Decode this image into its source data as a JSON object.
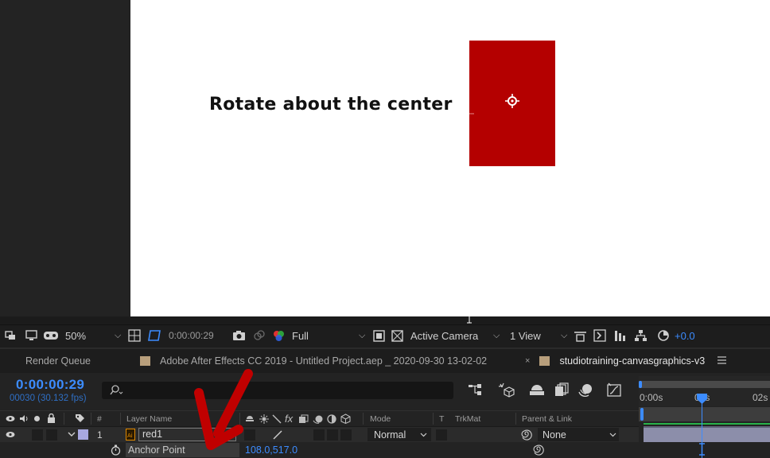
{
  "canvas": {
    "text": "Rotate about the center",
    "layer_color": "#b40000"
  },
  "viewer_toolbar": {
    "zoom": "50%",
    "timecode": "0:00:00:29",
    "resolution": "Full",
    "camera": "Active Camera",
    "view_layout": "1 View",
    "exposure": "+0.0"
  },
  "tabs": [
    {
      "label": "Render Queue",
      "active": false
    },
    {
      "label": "Adobe After Effects CC 2019 - Untitled Project.aep _ 2020-09-30 13-02-02",
      "swatch": "#b89f7c",
      "active": false
    },
    {
      "label": "studiotraining-canvasgraphics-v3",
      "swatch": "#b89f7c",
      "active": true,
      "close": "×"
    }
  ],
  "timeline": {
    "current_time": "0:00:00:29",
    "frame_info": "00030 (30.132 fps)",
    "columns": {
      "index": "#",
      "layer_name": "Layer Name",
      "switches": "fx",
      "mode": "Mode",
      "t": "T",
      "trkmat": "TrkMat",
      "parent": "Parent & Link"
    },
    "ruler": [
      "0:00s",
      "01s",
      "02s"
    ],
    "layer": {
      "index": "1",
      "name": "red1",
      "mode": "Normal",
      "parent": "None",
      "label_color": "#a8a8e0"
    },
    "property": {
      "name": "Anchor Point",
      "value": "108.0,517.0"
    }
  },
  "colors": {
    "accent": "#3c8cff",
    "annotation_arrow": "#c00000"
  }
}
